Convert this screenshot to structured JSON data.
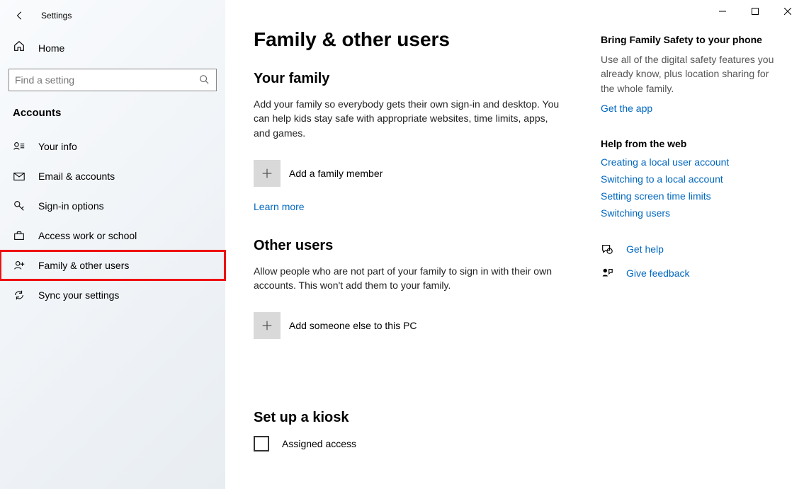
{
  "app": {
    "title": "Settings"
  },
  "sidebar": {
    "home": "Home",
    "search_placeholder": "Find a setting",
    "category": "Accounts",
    "items": [
      {
        "label": "Your info"
      },
      {
        "label": "Email & accounts"
      },
      {
        "label": "Sign-in options"
      },
      {
        "label": "Access work or school"
      },
      {
        "label": "Family & other users"
      },
      {
        "label": "Sync your settings"
      }
    ]
  },
  "page": {
    "title": "Family & other users",
    "family": {
      "heading": "Your family",
      "desc": "Add your family so everybody gets their own sign-in and desktop. You can help kids stay safe with appropriate websites, time limits, apps, and games.",
      "add_label": "Add a family member",
      "learn_more": "Learn more"
    },
    "other": {
      "heading": "Other users",
      "desc": "Allow people who are not part of your family to sign in with their own accounts. This won't add them to your family.",
      "add_label": "Add someone else to this PC"
    },
    "kiosk": {
      "heading": "Set up a kiosk",
      "assigned": "Assigned access"
    }
  },
  "right": {
    "safety": {
      "heading": "Bring Family Safety to your phone",
      "desc": "Use all of the digital safety features you already know, plus location sharing for the whole family.",
      "link": "Get the app"
    },
    "help": {
      "heading": "Help from the web",
      "links": [
        "Creating a local user account",
        "Switching to a local account",
        "Setting screen time limits",
        "Switching users"
      ]
    },
    "get_help": "Get help",
    "feedback": "Give feedback"
  }
}
